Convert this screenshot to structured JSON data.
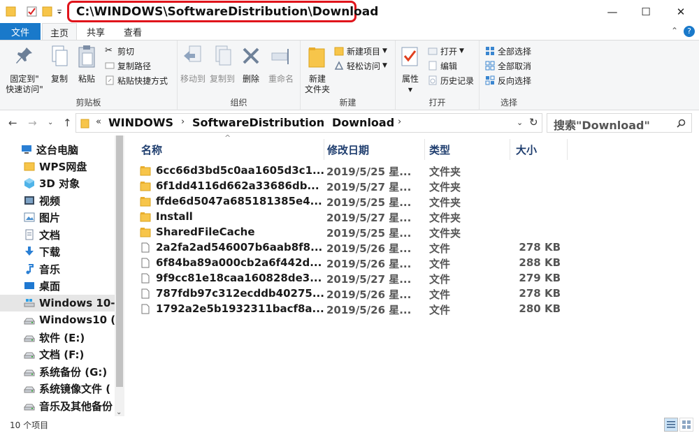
{
  "window": {
    "path_title": "C:\\WINDOWS\\SoftwareDistribution\\Download",
    "minimize_glyph": "—",
    "maximize_glyph": "☐",
    "close_glyph": "✕"
  },
  "ribbon_tabs": {
    "file": "文件",
    "home": "主页",
    "share": "共享",
    "view": "查看"
  },
  "ribbon": {
    "clipboard": {
      "label": "剪贴板",
      "pin_line1": "固定到\"",
      "pin_line2": "快速访问\"",
      "copy": "复制",
      "paste": "粘贴",
      "cut": "剪切",
      "copy_path": "复制路径",
      "paste_shortcut": "粘贴快捷方式"
    },
    "organize": {
      "label": "组织",
      "move_to": "移动到",
      "copy_to": "复制到",
      "delete": "删除",
      "rename": "重命名"
    },
    "new": {
      "label": "新建",
      "new_folder_line1": "新建",
      "new_folder_line2": "文件夹",
      "new_item": "新建项目",
      "easy_access": "轻松访问"
    },
    "open": {
      "label": "打开",
      "properties": "属性",
      "open": "打开",
      "edit": "编辑",
      "history": "历史记录"
    },
    "select": {
      "label": "选择",
      "select_all": "全部选择",
      "select_none": "全部取消",
      "invert": "反向选择"
    }
  },
  "address": {
    "prefix": "«",
    "crumbs": [
      "WINDOWS",
      "SoftwareDistribution",
      "Download"
    ],
    "search_placeholder": "搜索\"Download\""
  },
  "nav_pane": {
    "items": [
      {
        "label": "这台电脑",
        "icon": "computer-icon",
        "selected": false
      },
      {
        "label": "WPS网盘",
        "icon": "folder-icon",
        "selected": false
      },
      {
        "label": "3D 对象",
        "icon": "cube-icon",
        "selected": false
      },
      {
        "label": "视频",
        "icon": "video-icon",
        "selected": false
      },
      {
        "label": "图片",
        "icon": "picture-icon",
        "selected": false
      },
      {
        "label": "文档",
        "icon": "document-icon",
        "selected": false
      },
      {
        "label": "下载",
        "icon": "download-icon",
        "selected": false
      },
      {
        "label": "音乐",
        "icon": "music-icon",
        "selected": false
      },
      {
        "label": "桌面",
        "icon": "desktop-icon",
        "selected": false
      },
      {
        "label": "Windows 10-",
        "icon": "windows-drive-icon",
        "selected": true
      },
      {
        "label": "Windows10 (",
        "icon": "drive-icon",
        "selected": false
      },
      {
        "label": "软件 (E:)",
        "icon": "drive-icon",
        "selected": false
      },
      {
        "label": "文档 (F:)",
        "icon": "drive-icon",
        "selected": false
      },
      {
        "label": "系统备份 (G:)",
        "icon": "drive-icon",
        "selected": false
      },
      {
        "label": "系统镜像文件 (",
        "icon": "drive-icon",
        "selected": false
      },
      {
        "label": "音乐及其他备份",
        "icon": "drive-icon",
        "selected": false
      }
    ]
  },
  "file_list": {
    "columns": [
      "名称",
      "修改日期",
      "类型",
      "大小"
    ],
    "rows": [
      {
        "name": "6cc66d3bd5c0aa1605d3c1...",
        "date": "2019/5/25 星...",
        "type": "文件夹",
        "size": "",
        "kind": "folder"
      },
      {
        "name": "6f1dd4116d662a33686db...",
        "date": "2019/5/27 星...",
        "type": "文件夹",
        "size": "",
        "kind": "folder"
      },
      {
        "name": "ffde6d5047a685181385e4...",
        "date": "2019/5/25 星...",
        "type": "文件夹",
        "size": "",
        "kind": "folder"
      },
      {
        "name": "Install",
        "date": "2019/5/27 星...",
        "type": "文件夹",
        "size": "",
        "kind": "folder"
      },
      {
        "name": "SharedFileCache",
        "date": "2019/5/25 星...",
        "type": "文件夹",
        "size": "",
        "kind": "folder"
      },
      {
        "name": "2a2fa2ad546007b6aab8f8...",
        "date": "2019/5/26 星...",
        "type": "文件",
        "size": "278 KB",
        "kind": "file"
      },
      {
        "name": "6f84ba89a000cb2a6f442d...",
        "date": "2019/5/26 星...",
        "type": "文件",
        "size": "288 KB",
        "kind": "file"
      },
      {
        "name": "9f9cc81e18caa160828de3...",
        "date": "2019/5/27 星...",
        "type": "文件",
        "size": "279 KB",
        "kind": "file"
      },
      {
        "name": "787fdb97c312ecddb40275...",
        "date": "2019/5/26 星...",
        "type": "文件",
        "size": "278 KB",
        "kind": "file"
      },
      {
        "name": "1792a2e5b1932311bacf8a...",
        "date": "2019/5/26 星...",
        "type": "文件",
        "size": "280 KB",
        "kind": "file"
      }
    ]
  },
  "status_bar": {
    "item_count": "10 个项目"
  },
  "colors": {
    "accent": "#1979ca",
    "title_highlight": "#e0141b",
    "folder": "#f7c54a",
    "selection": "#e6e6e6"
  }
}
